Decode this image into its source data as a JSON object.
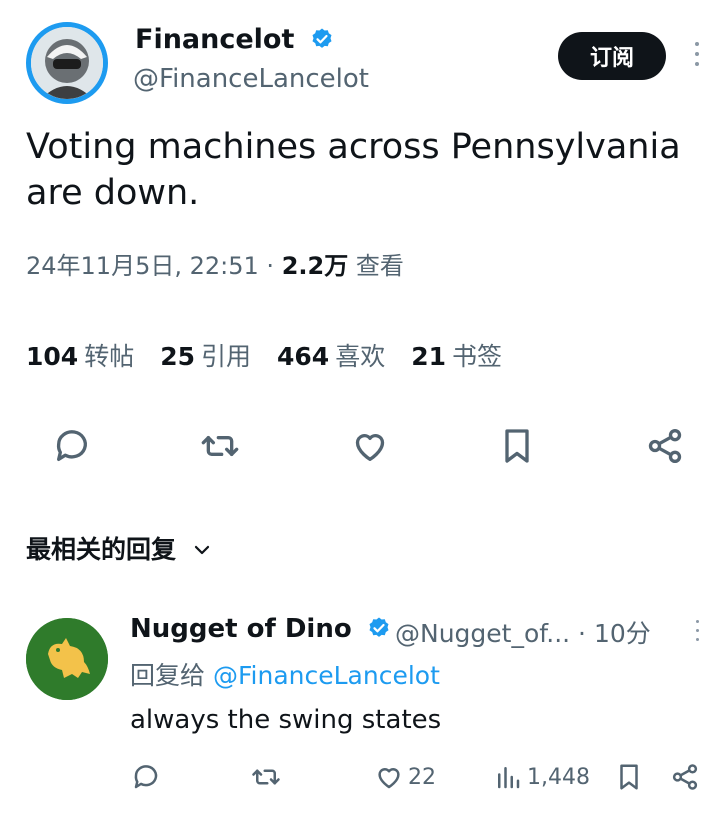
{
  "author": {
    "name": "Financelot",
    "handle": "@FinanceLancelot",
    "verified_icon": "verified-badge-icon",
    "accent": "#1d9bf0"
  },
  "subscribe_label": "订阅",
  "tweet": {
    "text": "Voting machines across Pennsylvania are down.",
    "timestamp": "24年11月5日, 22:51",
    "separator": "·",
    "views": "2.2万",
    "views_label": "查看"
  },
  "stats": [
    {
      "count": "104",
      "label": "转帖"
    },
    {
      "count": "25",
      "label": "引用"
    },
    {
      "count": "464",
      "label": "喜欢"
    },
    {
      "count": "21",
      "label": "书签"
    }
  ],
  "actions": [
    "reply-icon",
    "retweet-icon",
    "like-icon",
    "bookmark-icon",
    "share-icon"
  ],
  "replies_header": "最相关的回复",
  "reply": {
    "name": "Nugget of Dino",
    "handle": "@Nugget_of...",
    "time": "· 10分",
    "replying_prefix": "回复给",
    "replying_to": "@FinanceLancelot",
    "text": "always the swing states",
    "likes": "22",
    "views": "1,448"
  }
}
